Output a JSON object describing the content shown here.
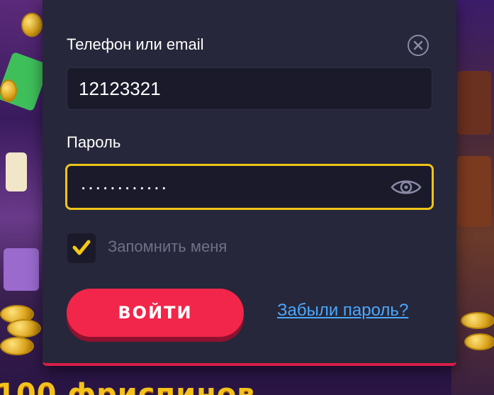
{
  "login": {
    "phone_label": "Телефон или email",
    "phone_value": "12123321",
    "password_label": "Пароль",
    "password_value": "············",
    "remember_label": "Запомнить меня",
    "remember_checked": true,
    "submit_label": "ВОЙТИ",
    "forgot_label": "Забыли пароль?"
  },
  "background": {
    "banner_text": "100 фриспинов"
  },
  "icons": {
    "close": "close-icon",
    "eye": "eye-icon",
    "check": "checkmark-icon"
  },
  "colors": {
    "modal_bg": "#26273a",
    "field_bg": "#1a1a2b",
    "focus_border": "#f0c419",
    "button": "#f2264a",
    "link": "#4aa8ff",
    "accent_bottom": "#d81e4a"
  }
}
